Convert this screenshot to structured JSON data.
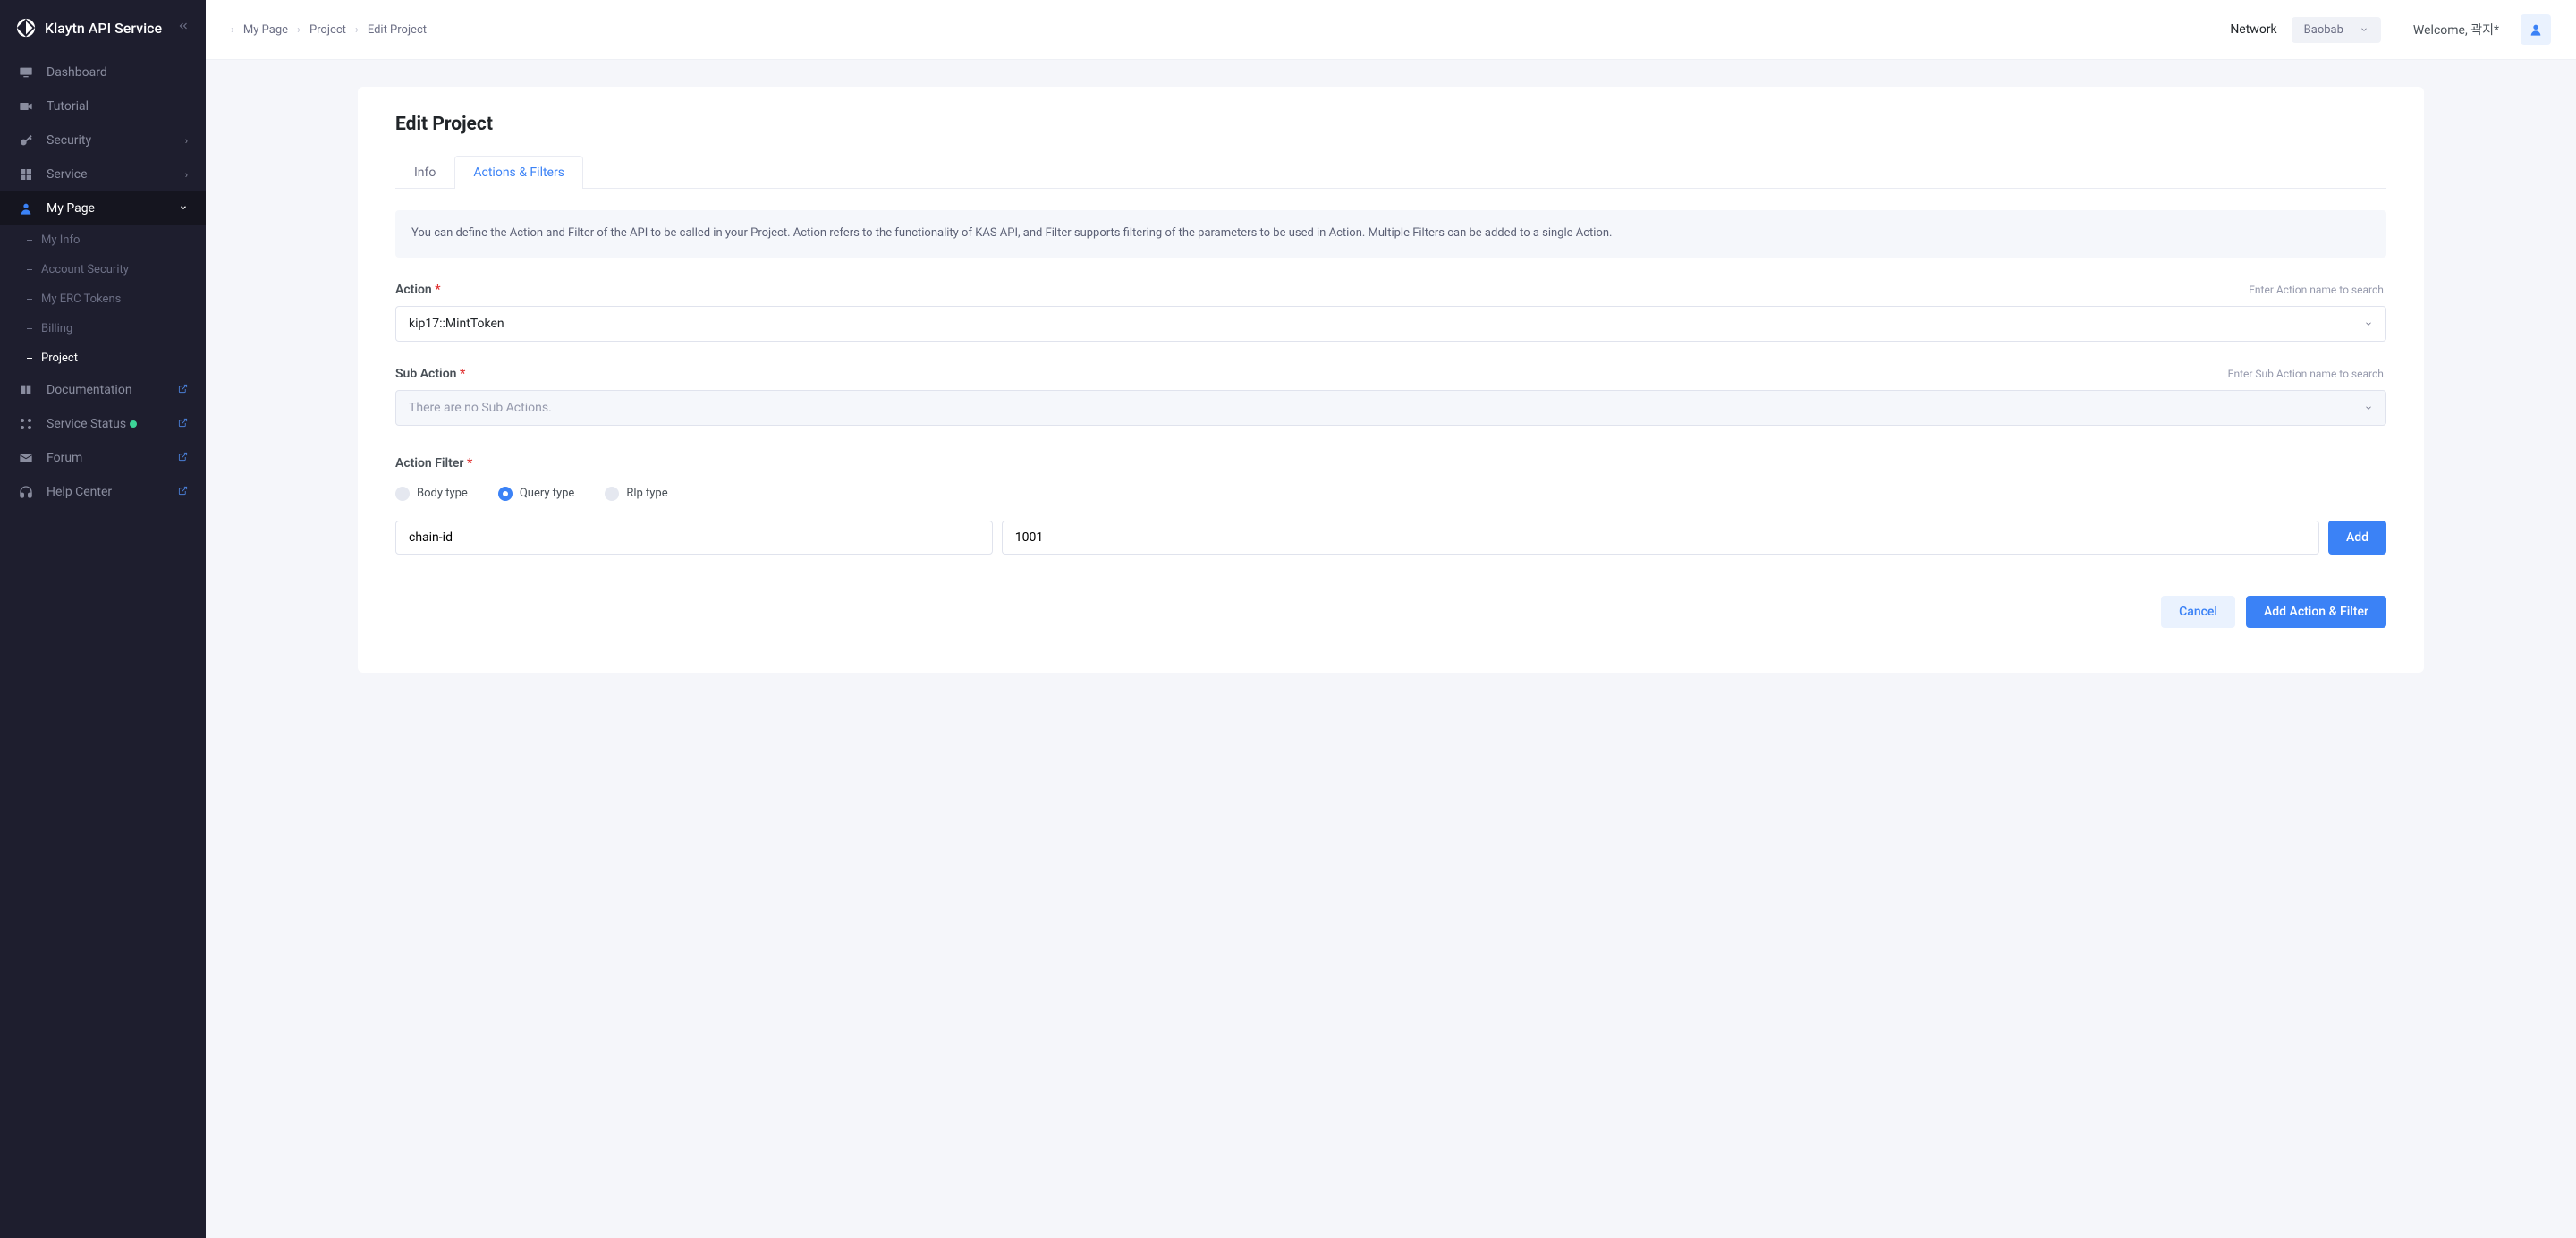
{
  "brand": "Klaytn API Service",
  "sidebar": {
    "items": [
      {
        "label": "Dashboard"
      },
      {
        "label": "Tutorial"
      },
      {
        "label": "Security"
      },
      {
        "label": "Service"
      },
      {
        "label": "My Page"
      },
      {
        "label": "Documentation"
      },
      {
        "label": "Service Status"
      },
      {
        "label": "Forum"
      },
      {
        "label": "Help Center"
      }
    ],
    "mypage_sub": [
      {
        "label": "My Info"
      },
      {
        "label": "Account Security"
      },
      {
        "label": "My ERC Tokens"
      },
      {
        "label": "Billing"
      },
      {
        "label": "Project"
      }
    ]
  },
  "breadcrumb": [
    "My Page",
    "Project",
    "Edit Project"
  ],
  "topbar": {
    "network_label": "Network",
    "network_value": "Baobab",
    "welcome_prefix": "Welcome, ",
    "welcome_user": "곽지*"
  },
  "page": {
    "title": "Edit Project",
    "tabs": [
      "Info",
      "Actions & Filters"
    ],
    "banner": "You can define the Action and Filter of the API to be called in your Project. Action refers to the functionality of KAS API, and Filter supports filtering of the parameters to be used in Action. Multiple Filters can be added to a single Action.",
    "action": {
      "label": "Action",
      "hint": "Enter Action name to search.",
      "value": "kip17::MintToken"
    },
    "sub_action": {
      "label": "Sub Action",
      "hint": "Enter Sub Action name to search.",
      "placeholder": "There are no Sub Actions."
    },
    "filter": {
      "label": "Action Filter",
      "options": [
        "Body type",
        "Query type",
        "Rlp type"
      ],
      "selected": "Query type",
      "key_value": "chain-id",
      "val_value": "1001",
      "add_btn": "Add"
    },
    "buttons": {
      "cancel": "Cancel",
      "submit": "Add Action & Filter"
    }
  }
}
